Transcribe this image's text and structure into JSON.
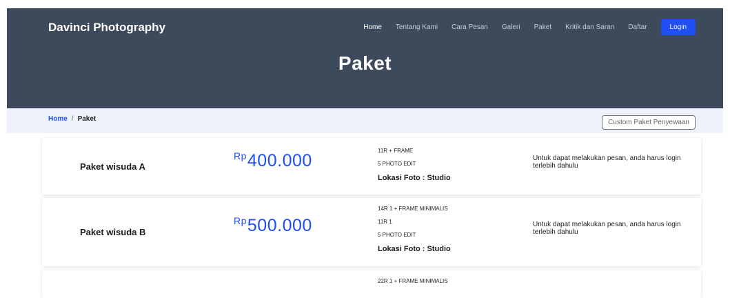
{
  "header": {
    "brand": "Davinci Photography",
    "nav": [
      "Home",
      "Tentang Kami",
      "Cara Pesan",
      "Galeri",
      "Paket",
      "Kritik dan Saran",
      "Daftar"
    ],
    "login_label": "Login",
    "page_title": "Paket"
  },
  "breadcrumb": {
    "home": "Home",
    "separator": "/",
    "current": "Paket",
    "custom_button": "Custom Paket Penyewaan"
  },
  "packages": [
    {
      "name": "Paket wisuda A",
      "currency": "Rp",
      "price": "400.000",
      "features": [
        "11R + FRAME",
        "5 PHOTO EDIT"
      ],
      "location": "Lokasi Foto : Studio",
      "note": "Untuk dapat melakukan pesan, anda harus login terlebih dahulu"
    },
    {
      "name": "Paket wisuda B",
      "currency": "Rp",
      "price": "500.000",
      "features": [
        "14R 1 + FRAME MINIMALIS",
        "11R 1",
        "5 PHOTO EDIT"
      ],
      "location": "Lokasi Foto : Studio",
      "note": "Untuk dapat melakukan pesan, anda harus login terlebih dahulu"
    },
    {
      "features": [
        "22R 1 + FRAME MINIMALIS"
      ]
    }
  ],
  "colors": {
    "header_bg": "#3d4a5c",
    "accent": "#1f4ef5",
    "breadcrumb_bg": "#eef3fb"
  }
}
